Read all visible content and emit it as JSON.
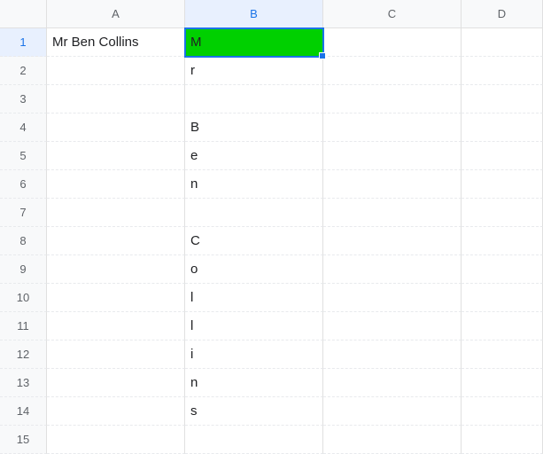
{
  "columns": [
    "A",
    "B",
    "C",
    "D"
  ],
  "rows": [
    "1",
    "2",
    "3",
    "4",
    "5",
    "6",
    "7",
    "8",
    "9",
    "10",
    "11",
    "12",
    "13",
    "14",
    "15"
  ],
  "selected": {
    "row": 1,
    "col": "B"
  },
  "cells": {
    "A1": "Mr Ben Collins",
    "B1": "M",
    "B2": "r",
    "B3": "",
    "B4": "B",
    "B5": "e",
    "B6": "n",
    "B7": "",
    "B8": "C",
    "B9": "o",
    "B10": "l",
    "B11": "l",
    "B12": "i",
    "B13": "n",
    "B14": "s"
  }
}
